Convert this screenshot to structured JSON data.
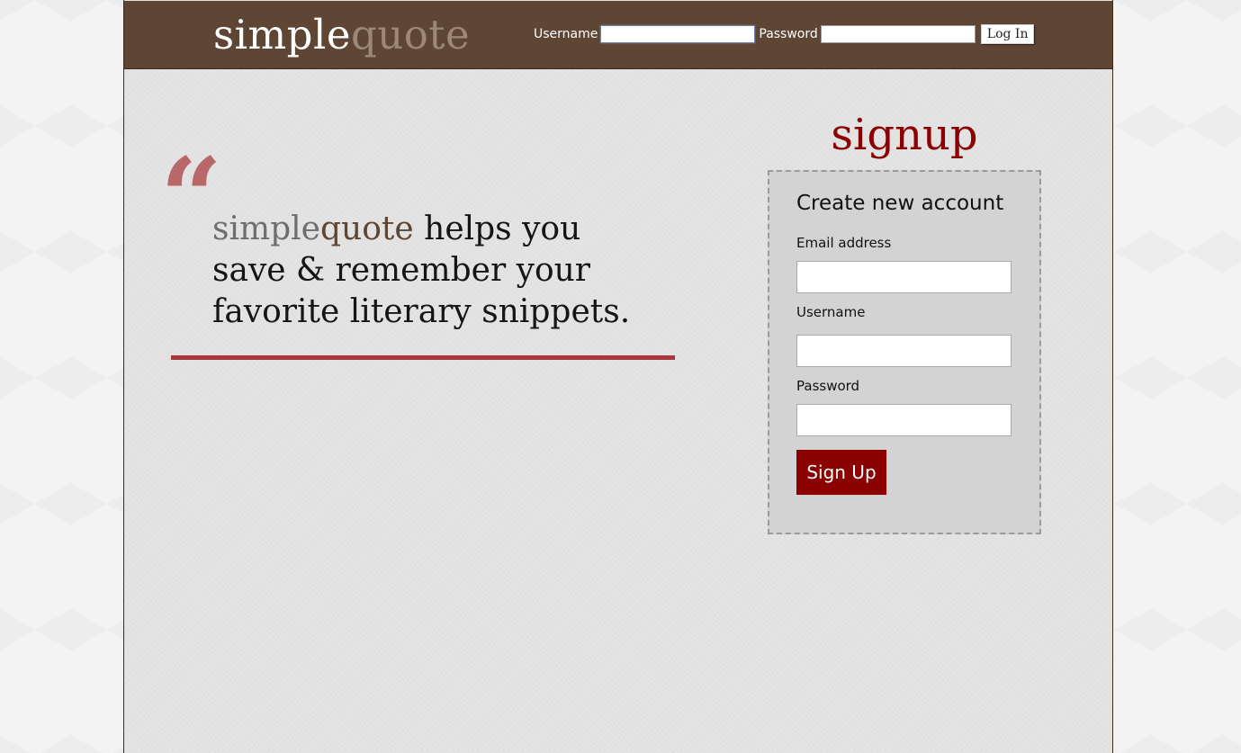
{
  "header": {
    "logo_part1": "simple",
    "logo_part2": "quote",
    "login": {
      "username_label": "Username",
      "username_value": "",
      "password_label": "Password",
      "password_value": "",
      "login_button": "Log In"
    }
  },
  "hero": {
    "quote_mark": "“",
    "brand_part1": "simple",
    "brand_part2": "quote",
    "tagline_line1_rest": " helps you",
    "tagline_line2": "save & remember your",
    "tagline_line3": "favorite literary snippets."
  },
  "signup": {
    "title": "signup",
    "heading": "Create new account",
    "email_label": "Email address",
    "email_value": "",
    "username_label": "Username",
    "username_value": "",
    "password_label": "Password",
    "password_value": "",
    "submit_label": "Sign Up"
  },
  "colors": {
    "header_bg": "#5e4534",
    "accent_red": "#8b0000",
    "divider_red": "#a8383e",
    "quote_mark": "#b86868",
    "logo_secondary": "#9c8877"
  }
}
